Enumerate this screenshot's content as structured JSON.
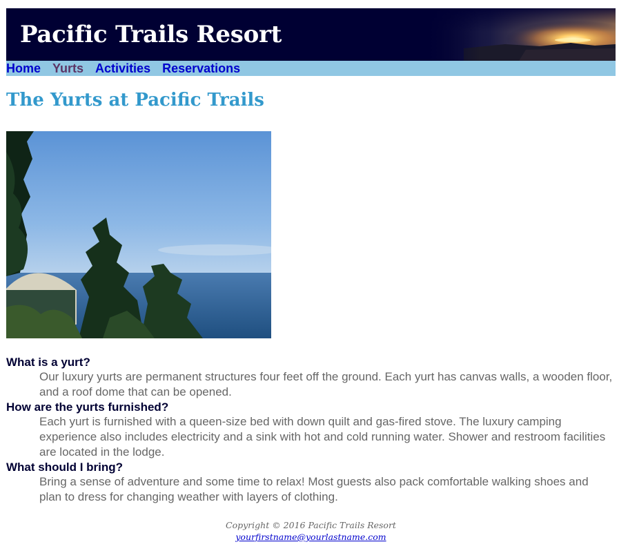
{
  "header": {
    "title": "Pacific Trails Resort"
  },
  "nav": {
    "items": [
      "Home",
      "Yurts",
      "Activities",
      "Reservations"
    ]
  },
  "main": {
    "heading": "The Yurts at Pacific Trails",
    "photo_icon": "yurt-ocean-photo",
    "faq": [
      {
        "question": "What is a yurt?",
        "answer": "Our luxury yurts are permanent structures four feet off the ground. Each yurt has canvas walls, a wooden floor, and a roof dome that can be opened."
      },
      {
        "question": "How are the yurts furnished?",
        "answer": "Each yurt is furnished with a queen-size bed with down quilt and gas-fired stove. The luxury camping experience also includes electricity and a sink with hot and cold running water. Shower and restroom facilities are located in the lodge."
      },
      {
        "question": "What should I bring?",
        "answer": "Bring a sense of adventure and some time to relax! Most guests also pack comfortable walking shoes and plan to dress for changing weather with layers of clothing."
      }
    ]
  },
  "footer": {
    "copyright": "Copyright © 2016 Pacific Trails Resort",
    "email": "yourfirstname@yourlastname.com"
  },
  "colors": {
    "header_bg": "#000033",
    "nav_bg": "#90c7e3",
    "heading": "#3399cc",
    "link": "#0000cc",
    "text": "#666666"
  }
}
